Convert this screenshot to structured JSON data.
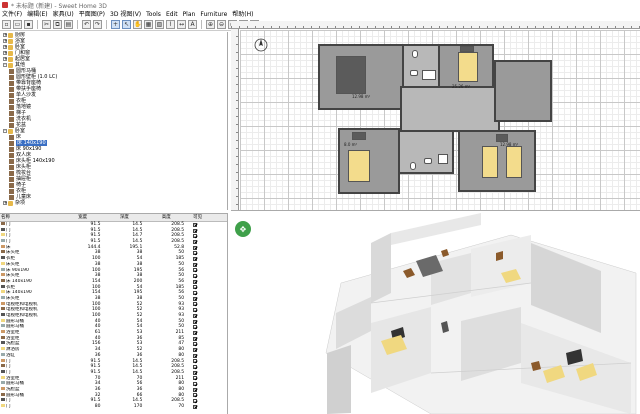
{
  "window": {
    "title": "* 未标题 (新建) - Sweet Home 3D"
  },
  "menu": [
    "文件(F)",
    "编辑(E)",
    "家具(U)",
    "平面图(P)",
    "3D 视图(V)",
    "Tools",
    "Edit",
    "Plan",
    "Furniture",
    "帮助(H)"
  ],
  "catalog": {
    "rows": [
      {
        "label": "厨房",
        "type": "folder",
        "indent": 1,
        "expander": "+"
      },
      {
        "label": "浴室",
        "type": "folder",
        "indent": 1,
        "expander": "+"
      },
      {
        "label": "卧室",
        "type": "folder",
        "indent": 1,
        "expander": "+"
      },
      {
        "label": "门和窗",
        "type": "folder",
        "indent": 1,
        "expander": "+"
      },
      {
        "label": "起居室",
        "type": "folder",
        "indent": 1,
        "expander": "+"
      },
      {
        "label": "其他",
        "type": "folder",
        "indent": 1,
        "expander": "-"
      },
      {
        "label": "圆形马桶",
        "type": "item",
        "indent": 3
      },
      {
        "label": "圆形壁柜 (1.0 LC)",
        "type": "item",
        "indent": 3
      },
      {
        "label": "带靠背座椅",
        "type": "item",
        "indent": 3
      },
      {
        "label": "带扶手座椅",
        "type": "item",
        "indent": 3
      },
      {
        "label": "单人沙发",
        "type": "item",
        "indent": 3
      },
      {
        "label": "衣柜",
        "type": "item",
        "indent": 3
      },
      {
        "label": "落地镜",
        "type": "item",
        "indent": 3
      },
      {
        "label": "梯子",
        "type": "item",
        "indent": 3
      },
      {
        "label": "洗衣机",
        "type": "item",
        "indent": 3
      },
      {
        "label": "花盆",
        "type": "item",
        "indent": 3
      },
      {
        "label": "卧室",
        "type": "folder",
        "indent": 1,
        "expander": "-"
      },
      {
        "label": "床",
        "type": "item",
        "indent": 3
      },
      {
        "label": "床 140x190",
        "type": "item",
        "indent": 3,
        "selected": true
      },
      {
        "label": "床 90x190",
        "type": "item",
        "indent": 3
      },
      {
        "label": "双人床",
        "type": "item",
        "indent": 3
      },
      {
        "label": "床头柜 140x190",
        "type": "item",
        "indent": 3
      },
      {
        "label": "床头柜",
        "type": "item",
        "indent": 3
      },
      {
        "label": "梳妆台",
        "type": "item",
        "indent": 3
      },
      {
        "label": "抽屉柜",
        "type": "item",
        "indent": 3
      },
      {
        "label": "椅子",
        "type": "item",
        "indent": 3
      },
      {
        "label": "衣柜",
        "type": "item",
        "indent": 3
      },
      {
        "label": "儿童床",
        "type": "item",
        "indent": 3
      },
      {
        "label": "杂项",
        "type": "folder",
        "indent": 1,
        "expander": "+"
      }
    ]
  },
  "table": {
    "headers": {
      "name": "名称",
      "width": "宽度",
      "depth": "深度",
      "height": "高度",
      "visible": "可见"
    },
    "rows": [
      {
        "name": "门",
        "w": "91.5",
        "d": "14.5",
        "h": "208.5"
      },
      {
        "name": "门",
        "w": "91.5",
        "d": "14.5",
        "h": "208.5"
      },
      {
        "name": "门",
        "w": "91.5",
        "d": "14.7",
        "h": "208.5"
      },
      {
        "name": "门",
        "w": "91.5",
        "d": "14.5",
        "h": "208.5"
      },
      {
        "name": "床",
        "w": "144.4",
        "d": "195.1",
        "h": "52.8"
      },
      {
        "name": "床头柜",
        "w": "38",
        "d": "38",
        "h": "50"
      },
      {
        "name": "衣柜",
        "w": "100",
        "d": "54",
        "h": "185"
      },
      {
        "name": "床头柜",
        "w": "38",
        "d": "38",
        "h": "50"
      },
      {
        "name": "床 90x190",
        "w": "100",
        "d": "195",
        "h": "56"
      },
      {
        "name": "床头柜",
        "w": "38",
        "d": "38",
        "h": "50"
      },
      {
        "name": "床 140x190",
        "w": "154",
        "d": "200",
        "h": "56"
      },
      {
        "name": "衣柜",
        "w": "100",
        "d": "54",
        "h": "185"
      },
      {
        "name": "床 140x190",
        "w": "154",
        "d": "195",
        "h": "56"
      },
      {
        "name": "床头柜",
        "w": "38",
        "d": "38",
        "h": "50"
      },
      {
        "name": "电视柜和电视机",
        "w": "100",
        "d": "52",
        "h": "93"
      },
      {
        "name": "电视柜和电视机",
        "w": "100",
        "d": "52",
        "h": "93"
      },
      {
        "name": "电视柜和电视机",
        "w": "100",
        "d": "52",
        "h": "93"
      },
      {
        "name": "圆形马桶",
        "w": "40",
        "d": "54",
        "h": "50"
      },
      {
        "name": "圆形马桶",
        "w": "40",
        "d": "54",
        "h": "50"
      },
      {
        "name": "浴室柜",
        "w": "61",
        "d": "53",
        "h": "211"
      },
      {
        "name": "浴室柜",
        "w": "40",
        "d": "36",
        "h": "85"
      },
      {
        "name": "洗脸盆",
        "w": "156",
        "d": "53",
        "h": "47"
      },
      {
        "name": "淋浴房",
        "w": "34",
        "d": "52",
        "h": "80"
      },
      {
        "name": "浴缸",
        "w": "36",
        "d": "36",
        "h": "80"
      },
      {
        "name": "门",
        "w": "91.5",
        "d": "14.5",
        "h": "208.5"
      },
      {
        "name": "门",
        "w": "91.5",
        "d": "14.5",
        "h": "208.5"
      },
      {
        "name": "门",
        "w": "91.5",
        "d": "14.5",
        "h": "208.5"
      },
      {
        "name": "浴室柜",
        "w": "70",
        "d": "70",
        "h": "211"
      },
      {
        "name": "圆形马桶",
        "w": "34",
        "d": "56",
        "h": "80"
      },
      {
        "name": "洗脸盆",
        "w": "36",
        "d": "36",
        "h": "80"
      },
      {
        "name": "圆形马桶",
        "w": "32",
        "d": "66",
        "h": "80"
      },
      {
        "name": "门",
        "w": "91.5",
        "d": "14.5",
        "h": "208.5"
      },
      {
        "name": "门",
        "w": "80",
        "d": "170",
        "h": "70"
      }
    ]
  },
  "plan": {
    "room_labels": [
      "12.98 m²",
      "25.26 m²",
      "8.0 m²",
      "12.98 m²"
    ],
    "ruler_marks": [
      "0",
      "100",
      "200",
      "300",
      "400",
      "500",
      "600",
      "700",
      "800",
      "900",
      "1000",
      "1100",
      "1200",
      "1300",
      "1400"
    ]
  }
}
